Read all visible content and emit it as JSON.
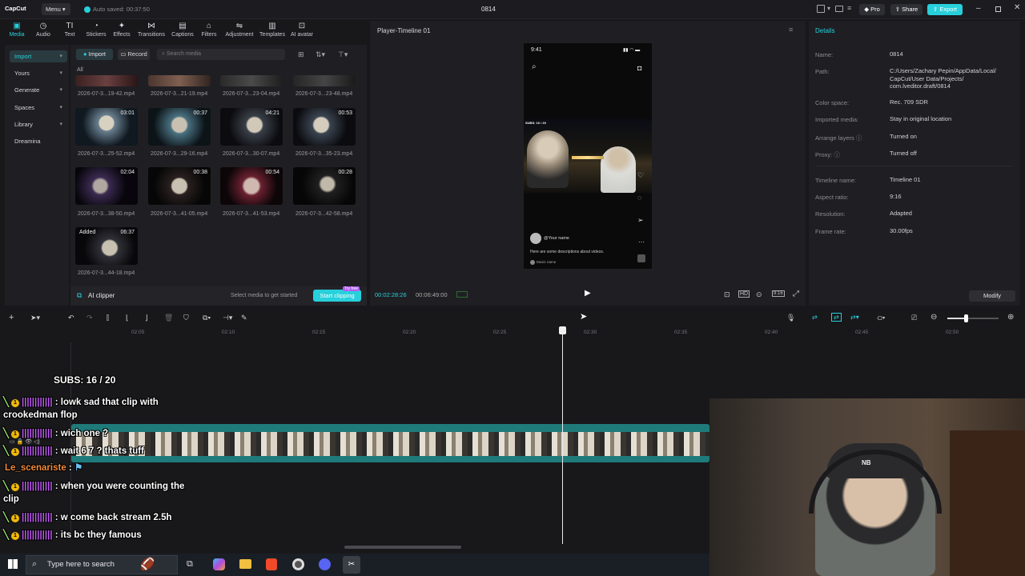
{
  "app": {
    "name": "CapCut",
    "menu_label": "Menu",
    "autosave": "Auto saved: 00:37:50",
    "project_title": "0814",
    "pro_label": "Pro",
    "share_label": "Share",
    "export_label": "Export"
  },
  "toolbar": {
    "items": [
      {
        "label": "Media",
        "icon": "media-icon"
      },
      {
        "label": "Audio",
        "icon": "audio-icon"
      },
      {
        "label": "Text",
        "icon": "text-icon"
      },
      {
        "label": "Stickers",
        "icon": "stickers-icon"
      },
      {
        "label": "Effects",
        "icon": "effects-icon"
      },
      {
        "label": "Transitions",
        "icon": "transitions-icon"
      },
      {
        "label": "Captions",
        "icon": "captions-icon"
      },
      {
        "label": "Filters",
        "icon": "filters-icon"
      },
      {
        "label": "Adjustment",
        "icon": "adjustment-icon"
      },
      {
        "label": "Templates",
        "icon": "templates-icon"
      },
      {
        "label": "AI avatar",
        "icon": "ai-avatar-icon"
      }
    ]
  },
  "sidebar": {
    "items": [
      "Import",
      "Yours",
      "Generate",
      "Spaces",
      "Library",
      "Dreamina"
    ]
  },
  "media": {
    "import_label": "Import",
    "record_label": "Record",
    "search_placeholder": "Search media",
    "filter_all": "All",
    "clips": [
      {
        "name": "2026-07-3...19-42.mp4",
        "duration": ""
      },
      {
        "name": "2026-07-3...21-19.mp4",
        "duration": ""
      },
      {
        "name": "2026-07-3...23-04.mp4",
        "duration": ""
      },
      {
        "name": "2026-07-3...23-48.mp4",
        "duration": ""
      },
      {
        "name": "2026-07-3...25-52.mp4",
        "duration": "03:01"
      },
      {
        "name": "2026-07-3...29-16.mp4",
        "duration": "00:37"
      },
      {
        "name": "2026-07-3...30-07.mp4",
        "duration": "04:21"
      },
      {
        "name": "2026-07-3...35-23.mp4",
        "duration": "00:53"
      },
      {
        "name": "2026-07-3...38-50.mp4",
        "duration": "02:04"
      },
      {
        "name": "2026-07-3...41-05.mp4",
        "duration": "00:38"
      },
      {
        "name": "2026-07-3...41-53.mp4",
        "duration": "00:54"
      },
      {
        "name": "2026-07-3...42-58.mp4",
        "duration": "00:28"
      },
      {
        "name": "2026-07-3...44-18.mp4",
        "duration": "06:37",
        "badge": "Added"
      }
    ],
    "ai_clipper_label": "AI clipper",
    "hint": "Select media to get started",
    "start_clipping_label": "Start clipping",
    "try_free": "Try free"
  },
  "player": {
    "title": "Player-Timeline 01",
    "current_time": "00:02:28:26",
    "total_time": "00:06:49:00",
    "phone": {
      "time": "9:41",
      "your_name": "@Your name",
      "description": "Here are some descriptions about videos.",
      "music": "Music name",
      "subs_tag": "SUBS: 16 / 20"
    }
  },
  "details": {
    "header": "Details",
    "rows": [
      {
        "label": "Name:",
        "value": "0814"
      },
      {
        "label": "Path:",
        "value": "C:/Users/Zachary Pepin/AppData/Local/ CapCut/User Data/Projects/ com.lveditor.draft/0814"
      },
      {
        "label": "Color space:",
        "value": "Rec. 709 SDR"
      },
      {
        "label": "Imported media:",
        "value": "Stay in original location"
      },
      {
        "label": "Arrange layers",
        "value": "Turned on"
      },
      {
        "label": "Proxy:",
        "value": "Turned off"
      },
      {
        "label": "Timeline name:",
        "value": "Timeline 01"
      },
      {
        "label": "Aspect ratio:",
        "value": "9:16"
      },
      {
        "label": "Resolution:",
        "value": "Adapted"
      },
      {
        "label": "Frame rate:",
        "value": "30.00fps"
      }
    ],
    "modify_label": "Modify"
  },
  "timeline": {
    "ticks": [
      "02:05",
      "02:10",
      "02:15",
      "02:20",
      "02:25",
      "02:30",
      "02:35",
      "02:40",
      "02:45",
      "02:50"
    ]
  },
  "chat": {
    "counter": "SUBS: 16 / 20",
    "messages": [
      {
        "user": "||||||||||||",
        "text": ": lowk sad that clip with",
        "cont": "crookedman flop"
      },
      {
        "user": "||||||||||||",
        "text": ": wich one ?"
      },
      {
        "user": "||||||||||||",
        "text": ": wait 6 7 ? thats tuff"
      },
      {
        "user": "Le_scenariste",
        "text": ":"
      },
      {
        "user": "||||||||||||",
        "text": ": when you were counting the",
        "cont": "clip"
      },
      {
        "user": "||||||||||||",
        "text": ": w come back stream 2.5h"
      },
      {
        "user": "||||||||||||",
        "text": ": its bc they famous"
      }
    ]
  },
  "taskbar": {
    "search_placeholder": "Type here to search"
  },
  "colors": {
    "accent": "#27d0db",
    "bg": "#18181b",
    "panel": "#1f1f23",
    "export": "#27d0db",
    "username": "#c25cf6",
    "badge": "#f0b90b"
  }
}
